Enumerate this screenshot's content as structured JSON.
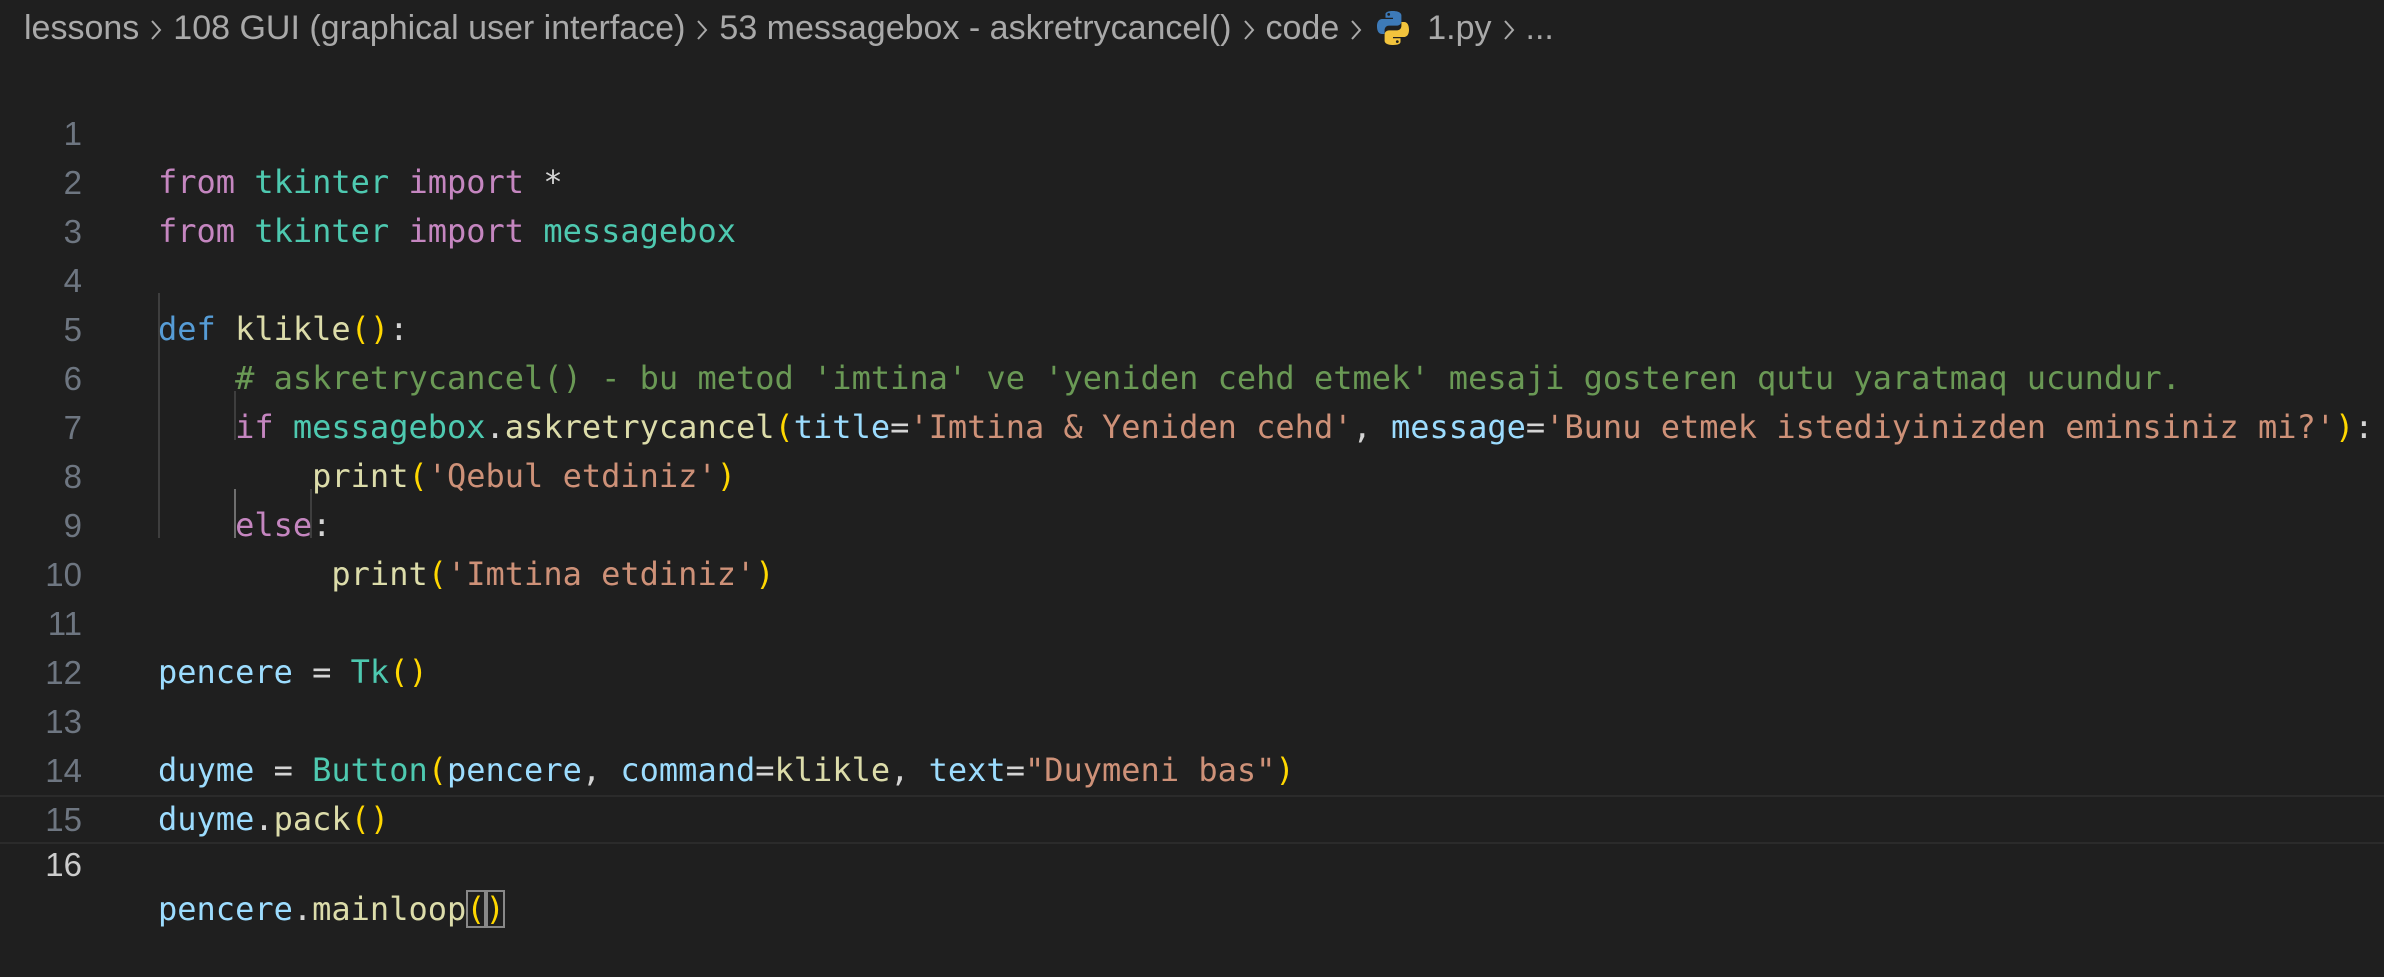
{
  "breadcrumb": {
    "items": [
      "lessons",
      "108 GUI (graphical user interface)",
      "53 messagebox - askretrycancel()",
      "code"
    ],
    "file": "1.py",
    "more": "..."
  },
  "editor": {
    "language": "python",
    "current_line": 16,
    "lines": [
      {
        "n": "1",
        "t": [
          "from",
          " ",
          "tkinter",
          " ",
          "import",
          " *"
        ]
      },
      {
        "n": "2",
        "t": [
          "from",
          " ",
          "tkinter",
          " ",
          "import",
          " ",
          "messagebox"
        ]
      },
      {
        "n": "3",
        "t": []
      },
      {
        "n": "4",
        "t": [
          "def",
          " ",
          "klikle",
          "(",
          ")",
          ":"
        ]
      },
      {
        "n": "5",
        "t": [
          "    ",
          "# askretrycancel() - bu metod 'imtina' ve 'yeniden cehd etmek' mesaji gosteren qutu yaratmaq ucundur."
        ]
      },
      {
        "n": "6",
        "t": [
          "    ",
          "if",
          " ",
          "messagebox",
          ".",
          "askretrycancel",
          "(",
          "title",
          "=",
          "'Imtina & Yeniden cehd'",
          ", ",
          "message",
          "=",
          "'Bunu etmek istediyinizden eminsiniz mi?'",
          ")",
          ":"
        ]
      },
      {
        "n": "7",
        "t": [
          "        ",
          "print",
          "(",
          "'Qebul etdiniz'",
          ")"
        ]
      },
      {
        "n": "8",
        "t": [
          "    ",
          "else",
          ":"
        ]
      },
      {
        "n": "9",
        "t": [
          "         ",
          "print",
          "(",
          "'Imtina etdiniz'",
          ")"
        ]
      },
      {
        "n": "10",
        "t": []
      },
      {
        "n": "11",
        "t": [
          "pencere",
          " = ",
          "Tk",
          "(",
          ")"
        ]
      },
      {
        "n": "12",
        "t": []
      },
      {
        "n": "13",
        "t": [
          "duyme",
          " = ",
          "Button",
          "(",
          "pencere",
          ", ",
          "command",
          "=",
          "klikle",
          ", ",
          "text",
          "=",
          "\"Duymeni bas\"",
          ")"
        ]
      },
      {
        "n": "14",
        "t": [
          "duyme",
          ".",
          "pack",
          "(",
          ")"
        ]
      },
      {
        "n": "15",
        "t": []
      },
      {
        "n": "16",
        "t": [
          "pencere",
          ".",
          "mainloop",
          "(",
          ")"
        ]
      }
    ]
  },
  "colors": {
    "background": "#1f1f1f",
    "keyword": "#c586c0",
    "def_keyword": "#569cd6",
    "module_class": "#4ec9b0",
    "function": "#dcdcaa",
    "variable": "#9cdcfe",
    "string": "#ce9178",
    "comment": "#6a9955",
    "bracket": "#ffd700"
  }
}
